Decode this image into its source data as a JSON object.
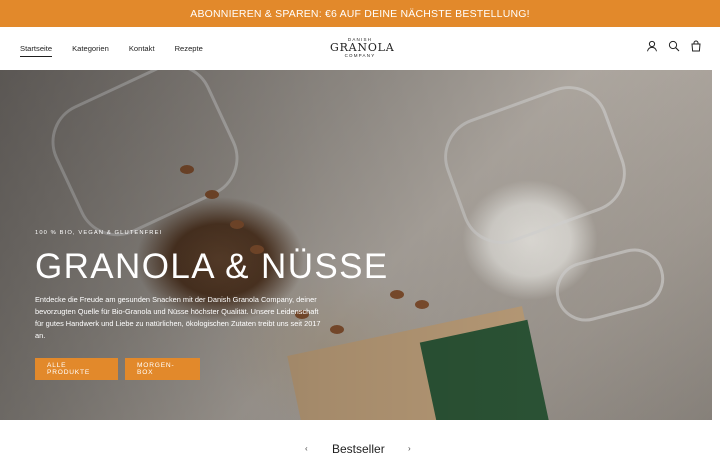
{
  "announcement": {
    "text": "ABONNIEREN & SPAREN: €6 AUF DEINE NÄCHSTE BESTELLUNG!"
  },
  "nav": {
    "items": [
      "Startseite",
      "Kategorien",
      "Kontakt",
      "Rezepte"
    ],
    "active": "Startseite"
  },
  "logo": {
    "top": "DANISH",
    "mid": "GRANOLA",
    "bot": "COMPANY"
  },
  "header_icons": [
    "account-icon",
    "search-icon",
    "cart-icon"
  ],
  "hero": {
    "eyebrow": "100 % BIO, VEGAN & GLUTENFREI",
    "headline": "GRANOLA & NÜSSE",
    "description": "Entdecke die Freude am gesunden Snacken mit der Danish Granola Company, deiner bevorzugten Quelle für Bio-Granola und Nüsse höchster Qualität. Unsere Leidenschaft für gutes Handwerk und Liebe zu natürlichen, ökologischen Zutaten treibt uns seit 2017 an.",
    "button_primary": "ALLE PRODUKTE",
    "button_secondary": "MORGEN-BOX"
  },
  "section": {
    "title": "Bestseller"
  },
  "colors": {
    "accent": "#e2892b",
    "text": "#1f1f1f"
  }
}
